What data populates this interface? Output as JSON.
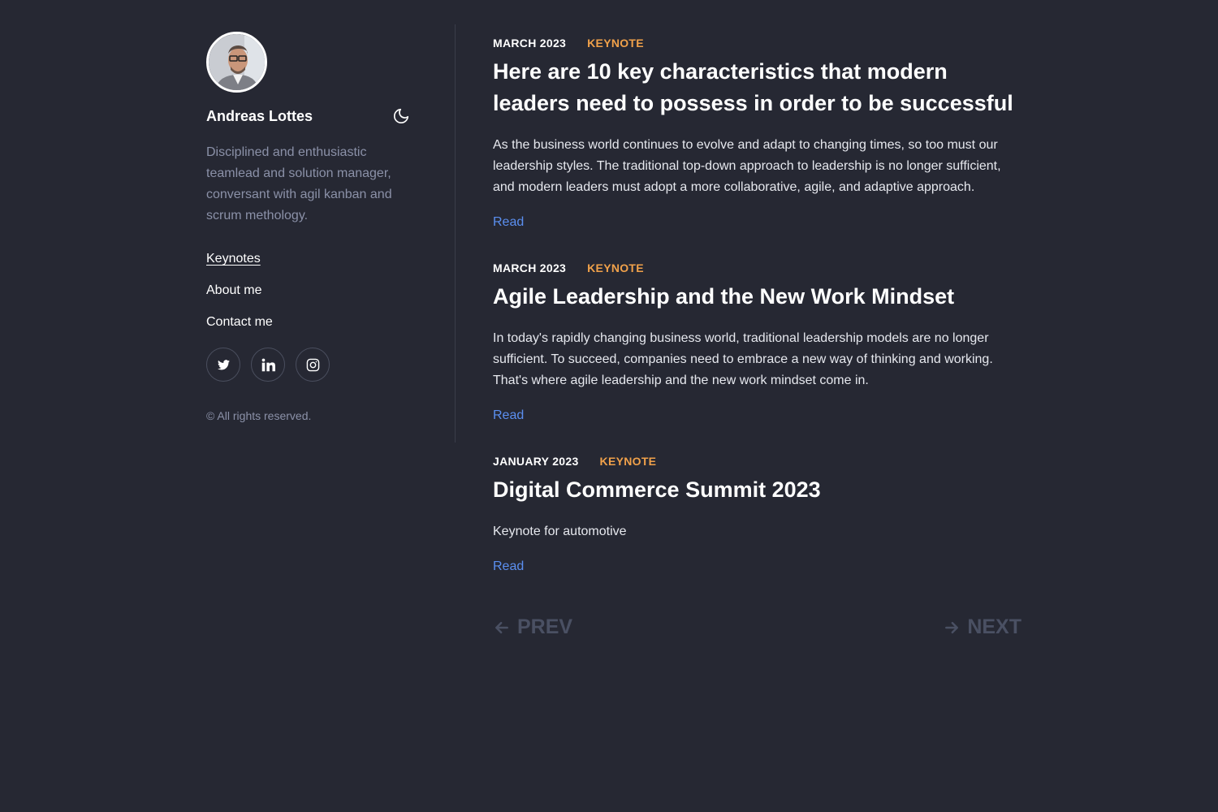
{
  "profile": {
    "name": "Andreas Lottes",
    "bio": "Disciplined and enthusiastic teamlead and solution manager, conversant with agil kanban and scrum methology."
  },
  "nav": {
    "items": [
      {
        "label": "Keynotes",
        "active": true
      },
      {
        "label": "About me",
        "active": false
      },
      {
        "label": "Contact me",
        "active": false
      }
    ]
  },
  "social": [
    "twitter-icon",
    "linkedin-icon",
    "instagram-icon"
  ],
  "footer": {
    "copyright": "© All rights reserved."
  },
  "articles": [
    {
      "date": "MARCH 2023",
      "tag": "KEYNOTE",
      "title": "Here are 10 key characteristics that modern leaders need to possess in order to be successful",
      "excerpt": "As the business world continues to evolve and adapt to changing times, so too must our leadership styles. The traditional top-down approach to leadership is no longer sufficient, and modern leaders must adopt a more collaborative, agile, and adaptive approach.",
      "read_label": "Read"
    },
    {
      "date": "MARCH 2023",
      "tag": "KEYNOTE",
      "title": "Agile Leadership and the New Work Mindset",
      "excerpt": "In today's rapidly changing business world, traditional leadership models are no longer sufficient. To succeed, companies need to embrace a new way of thinking and working. That's where agile leadership and the new work mindset come in.",
      "read_label": "Read"
    },
    {
      "date": "JANUARY 2023",
      "tag": "KEYNOTE",
      "title": "Digital Commerce Summit 2023",
      "excerpt": "Keynote for automotive",
      "read_label": "Read"
    }
  ],
  "pager": {
    "prev": "PREV",
    "next": "NEXT"
  },
  "colors": {
    "background": "#262833",
    "accent": "#f0a14a",
    "link": "#5b8ff0",
    "muted": "#8b91a8"
  }
}
